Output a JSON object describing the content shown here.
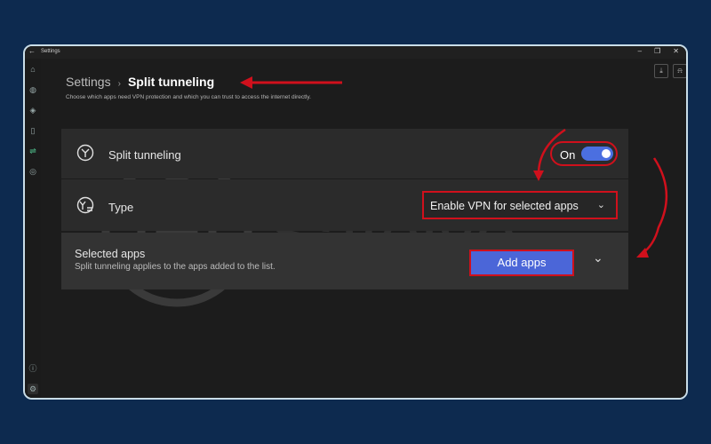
{
  "window": {
    "title": "Settings"
  },
  "breadcrumb": {
    "parent": "Settings",
    "separator": "›",
    "current": "Split tunneling"
  },
  "subtitle": "Choose which apps need VPN protection and which you can trust to access the internet directly.",
  "split_tunneling": {
    "label": "Split tunneling",
    "toggle_state": "On"
  },
  "type_row": {
    "label": "Type",
    "selected_value": "Enable VPN for selected apps"
  },
  "selected_apps": {
    "title": "Selected apps",
    "description": "Split tunneling applies to the apps added to the list.",
    "add_button": "Add apps"
  },
  "watermark": "Safelyo",
  "colors": {
    "accent": "#4b6fe0",
    "highlight": "#d0101c",
    "background": "#0d2a4f"
  }
}
